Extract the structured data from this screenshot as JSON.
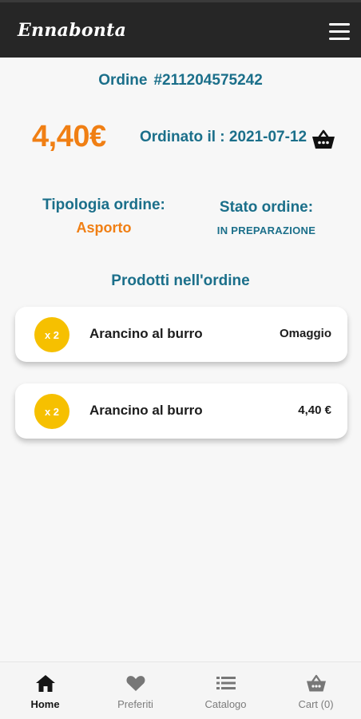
{
  "header": {
    "app_title": "Ennabonta",
    "menu_icon": "hamburger-menu-icon"
  },
  "order": {
    "number_label": "Ordine",
    "number": "#211204575242",
    "total": "4,40€",
    "date_text": "Ordinato il : 2021-07-12",
    "basket_icon": "basket-icon",
    "type_label": "Tipologia ordine:",
    "type_value": "Asporto",
    "state_label": "Stato ordine:",
    "state_value": "IN PREPARAZIONE"
  },
  "products": {
    "title": "Prodotti nell'ordine",
    "items": [
      {
        "qty": "x 2",
        "name": "Arancino al burro",
        "price": "Omaggio"
      },
      {
        "qty": "x 2",
        "name": "Arancino al burro",
        "price": "4,40 €"
      }
    ]
  },
  "bottom_nav": {
    "items": [
      {
        "label": "Home",
        "icon": "home-icon",
        "active": true
      },
      {
        "label": "Preferiti",
        "icon": "heart-icon",
        "active": false
      },
      {
        "label": "Catalogo",
        "icon": "list-icon",
        "active": false
      },
      {
        "label": "Cart (0)",
        "icon": "cart-icon",
        "active": false
      }
    ]
  },
  "colors": {
    "header_bg": "#262626",
    "primary_blue": "#1b6f8a",
    "accent_orange": "#f07f14",
    "qty_badge": "#f6c000"
  }
}
